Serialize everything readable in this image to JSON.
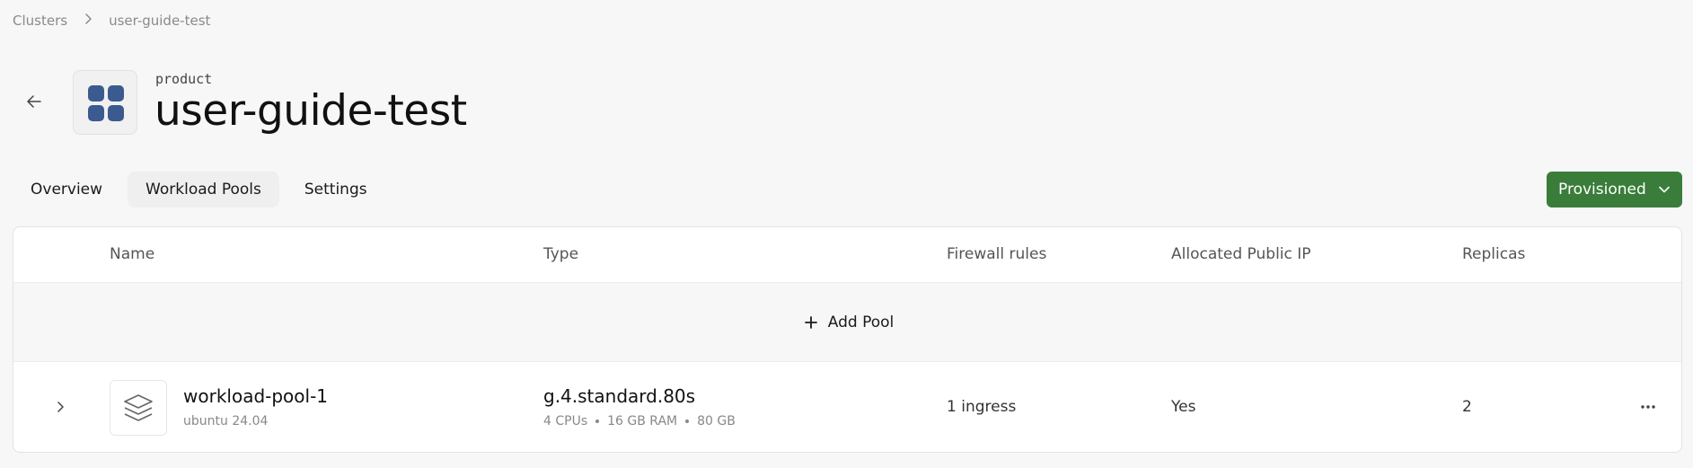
{
  "breadcrumb": {
    "items": [
      "Clusters",
      "user-guide-test"
    ]
  },
  "header": {
    "subtitle": "product",
    "title": "user-guide-test"
  },
  "tabs": [
    {
      "label": "Overview",
      "active": false
    },
    {
      "label": "Workload Pools",
      "active": true
    },
    {
      "label": "Settings",
      "active": false
    }
  ],
  "status": {
    "label": "Provisioned",
    "color": "#3a7d3a"
  },
  "table": {
    "columns": [
      "Name",
      "Type",
      "Firewall rules",
      "Allocated Public IP",
      "Replicas"
    ],
    "add_label": "Add Pool",
    "rows": [
      {
        "name": "workload-pool-1",
        "os": "ubuntu 24.04",
        "type": "g.4.standard.80s",
        "cpus": "4 CPUs",
        "ram": "16 GB RAM",
        "disk": "80 GB",
        "firewall": "1 ingress",
        "public_ip": "Yes",
        "replicas": "2"
      }
    ]
  },
  "icons": {
    "back": "arrow-left-icon",
    "expand": "chevron-right-icon",
    "dropdown": "chevron-down-icon",
    "add": "plus-icon",
    "pool": "layers-icon",
    "app": "grid-icon",
    "more": "more-horizontal-icon"
  },
  "colors": {
    "accent": "#3b5a8f",
    "status": "#3a7d3a"
  }
}
